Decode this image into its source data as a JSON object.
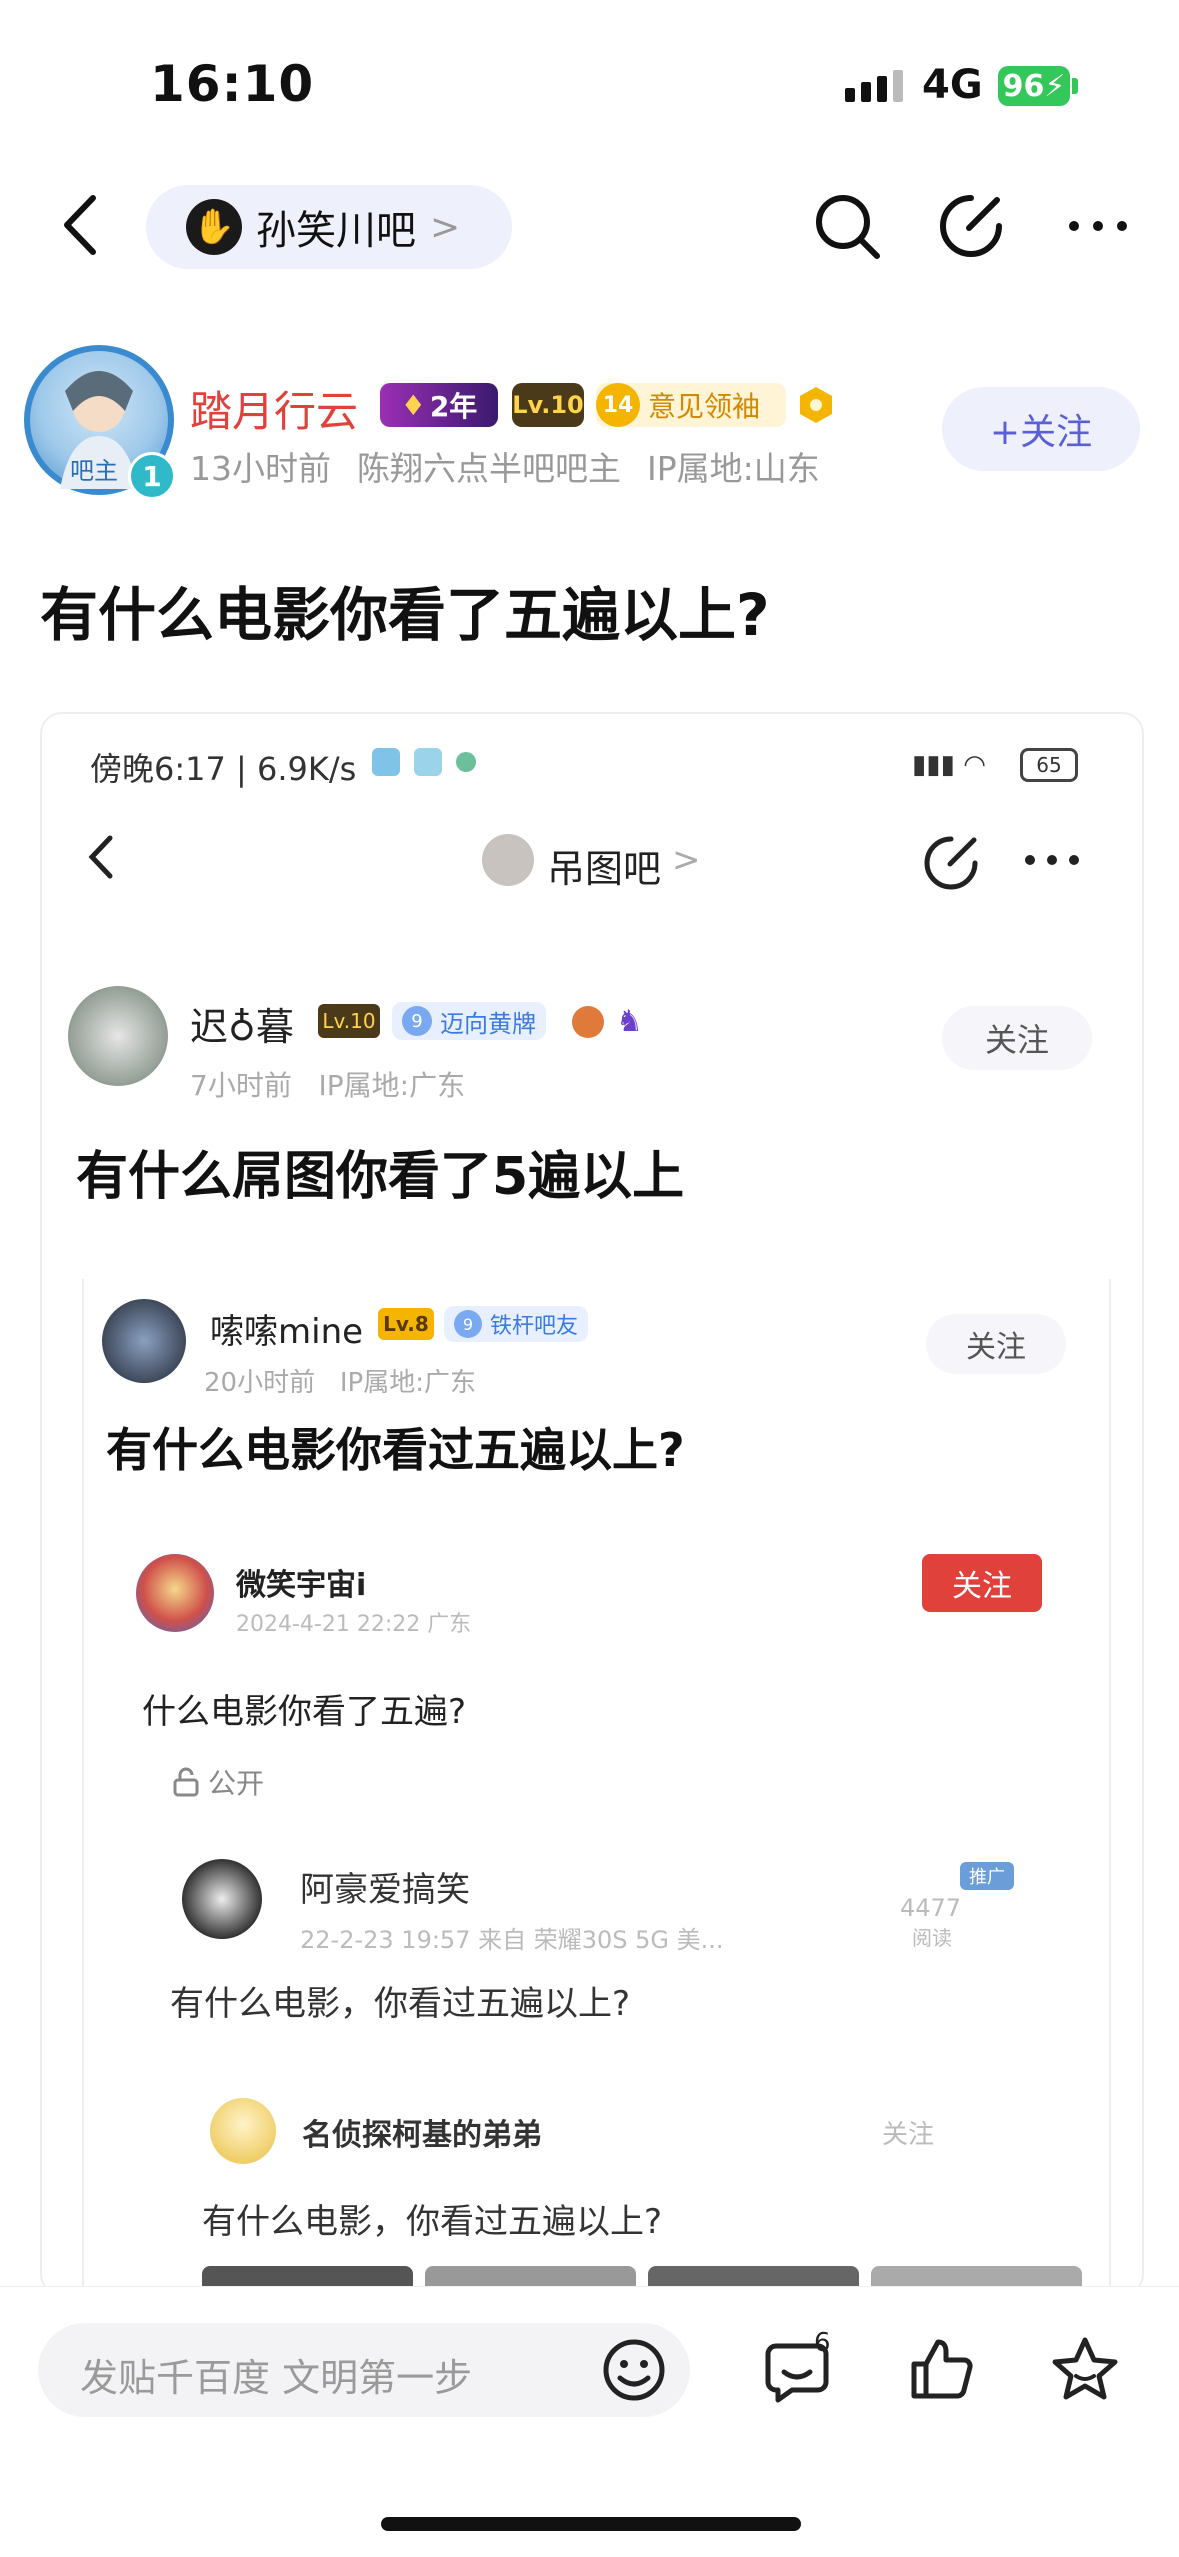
{
  "status_bar": {
    "time": "16:10",
    "network": "4G",
    "battery": "96"
  },
  "nav": {
    "forum_name": "孙笑川吧",
    "forum_chevron": ">"
  },
  "post": {
    "author": "踏月行云",
    "avatar_badge": "1",
    "avatar_caption": "吧主",
    "badges": {
      "years": "2年",
      "level": "Lv.10",
      "opinion_level": "14",
      "opinion_label": "意见领袖"
    },
    "time": "13小时前",
    "role": "陈翔六点半吧吧主",
    "ip": "IP属地:山东",
    "follow_label": "+关注",
    "title": "有什么电影你看了五遍以上?"
  },
  "screenshot": {
    "status": {
      "time_speed": "傍晚6:17 | 6.9K/s",
      "battery": "65"
    },
    "nav": {
      "forum": "吊图吧",
      "chevron": ">"
    },
    "post": {
      "author": "迟♁暮",
      "level": "Lv.10",
      "badge_level": "9",
      "badge_label": "迈向黄牌",
      "time": "7小时前",
      "ip": "IP属地:广东",
      "follow": "关注",
      "title": "有什么屌图你看了5遍以上"
    },
    "nested": {
      "author": "嗦嗦mine",
      "level": "Lv.8",
      "badge_level": "9",
      "badge_label": "铁杆吧友",
      "time": "20小时前",
      "ip": "IP属地:广东",
      "follow": "关注",
      "title": "有什么电影你看过五遍以上?"
    },
    "weibo": {
      "author": "微笑宇宙i",
      "date": "2024-4-21 22:22 广东",
      "follow": "关注",
      "text": "什么电影你看了五遍?",
      "visibility": "公开"
    },
    "reply1": {
      "author": "阿豪爱搞笑",
      "date_source": "22-2-23 19:57  来自 荣耀30S 5G 美...",
      "views": "4477",
      "views_label": "阅读",
      "tag": "推广",
      "text": "有什么电影，你看过五遍以上?"
    },
    "reply2": {
      "author": "名侦探柯基的弟弟",
      "follow": "关注",
      "text": "有什么电影，你看过五遍以上?"
    }
  },
  "bottom": {
    "reply_placeholder": "发贴千百度 文明第一步",
    "comment_count": "6"
  },
  "colors": {
    "accent": "#5b5fd6",
    "author_red": "#e0413b",
    "follow_bg": "#eef0fb",
    "battery_green": "#34c759"
  }
}
